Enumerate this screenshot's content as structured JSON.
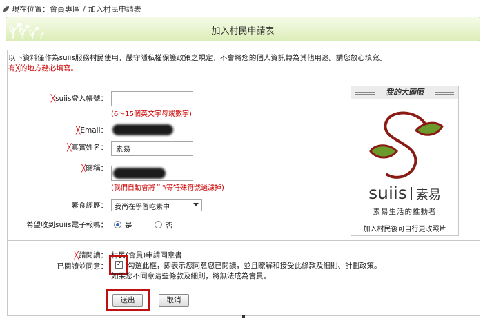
{
  "breadcrumb": {
    "prefix": "現在位置：",
    "item1": "會員專區",
    "separator": "/",
    "item2": "加入村民申請表"
  },
  "header": {
    "title": "加入村民申請表"
  },
  "notice": {
    "line1": "以下資料僅作為suiis服務村民使用，嚴守隱私權保護政策之規定，不會將您的個人資訊轉為其他用途。請您放心填寫。",
    "line2": "有╳的地方務必填寫。"
  },
  "form": {
    "required_mark": "╳",
    "account": {
      "label": "suiis登入帳號：",
      "value": "",
      "hint": "(6～15個英文字母或數字)"
    },
    "email": {
      "label": "Email："
    },
    "real_name": {
      "label": "真實姓名：",
      "value": "素易"
    },
    "nickname": {
      "label": "暱稱：",
      "hint": "(我們自動會將＂'\\等特殊符號過濾掉)"
    },
    "diet": {
      "label": "素食經歷：",
      "selected": "我尚在學習吃素中"
    },
    "newsletter": {
      "label": "希望收到suiis電子報嗎：",
      "yes": "是",
      "no": "否",
      "selected": "是"
    }
  },
  "photo_panel": {
    "title": "我的大頭照",
    "brand_en": "suiis",
    "brand_zh": "素易",
    "tagline": "素易生活的推動者",
    "footer": "加入村民後可自行更改照片",
    "colors": {
      "leaf": "#6a9a2c",
      "stroke": "#8a1a14"
    }
  },
  "agreement": {
    "read_label": "請閱讀：",
    "link_text": "村民(會員)申請同意書",
    "agree_label": "已閱讀並同意：",
    "checkbox_checked": true,
    "text_line1": "勾選此框，即表示您同意您已閱讀，並且瞭解和接受此條款及細則、計劃政策。",
    "text_line2": "如果您不同意這些條款及細則，將無法成為會員。"
  },
  "buttons": {
    "submit": "送出",
    "cancel": "取消"
  },
  "highlight_color": "#c01010"
}
